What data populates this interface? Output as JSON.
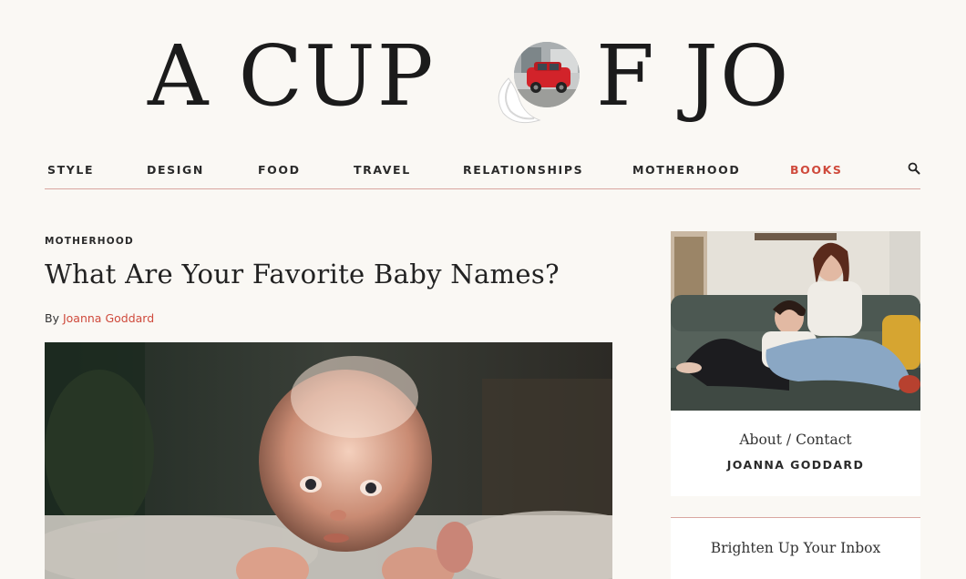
{
  "logo": {
    "left_text": "A CUP",
    "right_text": "F JO",
    "brand_color": "#1b1b1b"
  },
  "nav": {
    "items": [
      {
        "label": "STYLE"
      },
      {
        "label": "DESIGN"
      },
      {
        "label": "FOOD"
      },
      {
        "label": "TRAVEL"
      },
      {
        "label": "RELATIONSHIPS"
      },
      {
        "label": "MOTHERHOOD"
      },
      {
        "label": "BOOKS",
        "active": true
      }
    ],
    "search_icon": "search-icon",
    "accent_color": "#cf4a3c"
  },
  "post": {
    "category": "MOTHERHOOD",
    "title": "What Are Your Favorite Baby Names?",
    "byline_prefix": "By",
    "author": "Joanna Goddard"
  },
  "sidebar": {
    "about_label": "About / Contact",
    "author_name": "JOANNA GODDARD",
    "newsletter_label": "Brighten Up Your Inbox"
  }
}
